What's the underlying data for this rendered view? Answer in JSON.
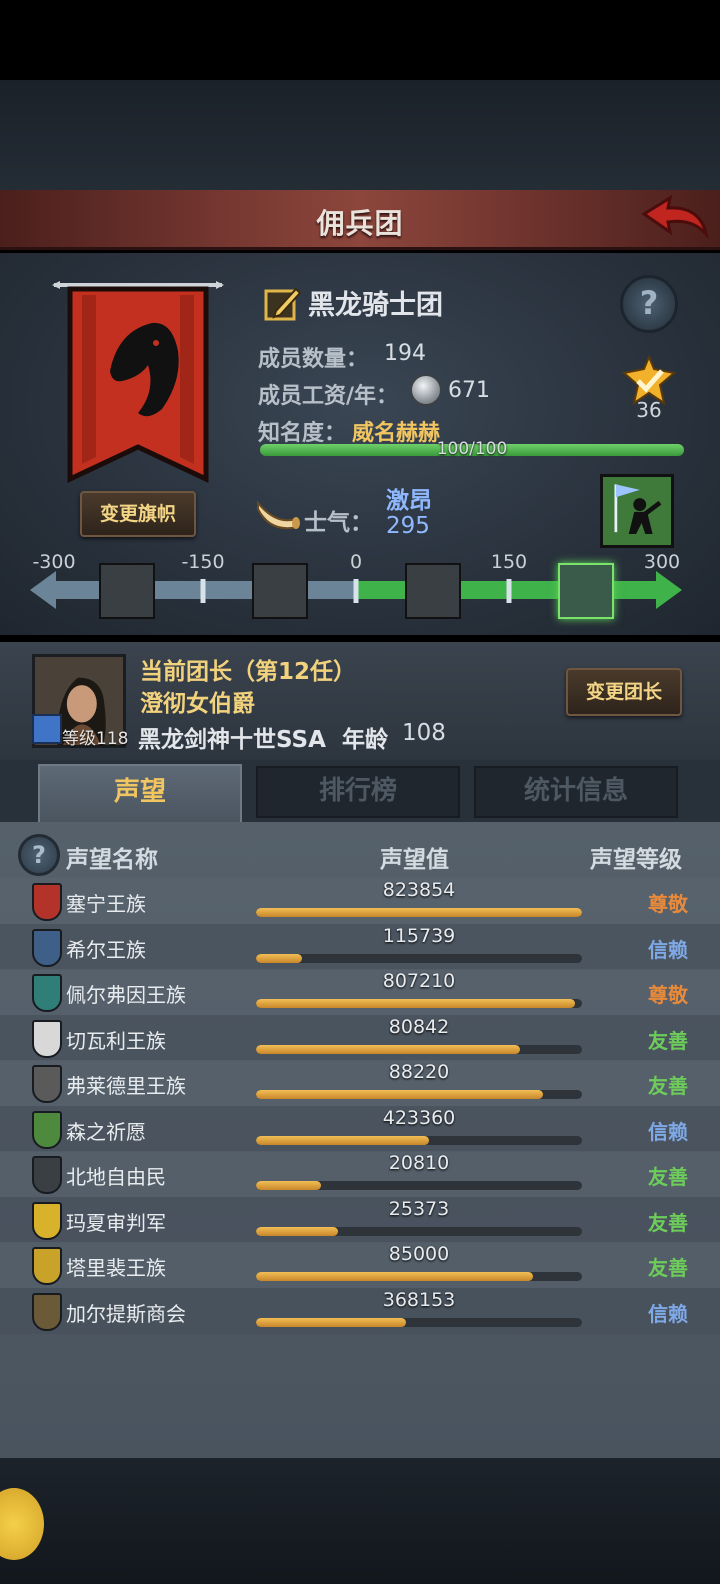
{
  "header": {
    "title": "佣兵团"
  },
  "guild": {
    "name": "黑龙骑士团",
    "members_label": "成员数量：",
    "members_value": "194",
    "wage_label": "成员工资/年：",
    "wage_value": "671",
    "fame_label": "知名度：",
    "fame_state": "威名赫赫",
    "fame_text": "100/100",
    "fame_fraction": 1.0,
    "rank_value": "36",
    "change_banner_label": "变更旗帜",
    "help_glyph": "?"
  },
  "morale": {
    "label": "士气：",
    "state": "激昂",
    "value": "295",
    "ticks": [
      "-300",
      "-150",
      "0",
      "150",
      "300"
    ],
    "current": 295,
    "states": [
      "panic-icon",
      "fear-icon",
      "calm-icon",
      "charge-icon"
    ],
    "active_state": 3
  },
  "leader": {
    "title": "当前团长（第12任）",
    "name": "澄彻女伯爵",
    "level_label": "等级118",
    "line": "黑龙剑神十世SSA",
    "age_label": "年龄",
    "age_value": "108",
    "change_leader_label": "变更团长"
  },
  "tabs": [
    {
      "label": "声望",
      "active": true
    },
    {
      "label": "排行榜",
      "active": false
    },
    {
      "label": "统计信息",
      "active": false
    }
  ],
  "reputation": {
    "headers": {
      "name": "声望名称",
      "value": "声望值",
      "level": "声望等级"
    },
    "help_glyph": "?",
    "rows": [
      {
        "name": "塞宁王族",
        "value": "823854",
        "fraction": 1.0,
        "level": "尊敬",
        "level_color": "#e88a3a",
        "crest_color": "#b3322a"
      },
      {
        "name": "希尔王族",
        "value": "115739",
        "fraction": 0.14,
        "level": "信赖",
        "level_color": "#7fa9e6",
        "crest_color": "#3e5f87"
      },
      {
        "name": "佩尔弗因王族",
        "value": "807210",
        "fraction": 0.98,
        "level": "尊敬",
        "level_color": "#e88a3a",
        "crest_color": "#2f7e78"
      },
      {
        "name": "切瓦利王族",
        "value": "80842",
        "fraction": 0.81,
        "level": "友善",
        "level_color": "#6dcc5a",
        "crest_color": "#d8d8d8"
      },
      {
        "name": "弗莱德里王族",
        "value": "88220",
        "fraction": 0.88,
        "level": "友善",
        "level_color": "#6dcc5a",
        "crest_color": "#5a5a5a"
      },
      {
        "name": "森之祈愿",
        "value": "423360",
        "fraction": 0.53,
        "level": "信赖",
        "level_color": "#7fa9e6",
        "crest_color": "#4e8a3e"
      },
      {
        "name": "北地自由民",
        "value": "20810",
        "fraction": 0.2,
        "level": "友善",
        "level_color": "#6dcc5a",
        "crest_color": "#3a3f44"
      },
      {
        "name": "玛夏审判军",
        "value": "25373",
        "fraction": 0.25,
        "level": "友善",
        "level_color": "#6dcc5a",
        "crest_color": "#d8b22a"
      },
      {
        "name": "塔里裴王族",
        "value": "85000",
        "fraction": 0.85,
        "level": "友善",
        "level_color": "#6dcc5a",
        "crest_color": "#c9a22a"
      },
      {
        "name": "加尔提斯商会",
        "value": "368153",
        "fraction": 0.46,
        "level": "信赖",
        "level_color": "#7fa9e6",
        "crest_color": "#6a5a38"
      }
    ]
  }
}
